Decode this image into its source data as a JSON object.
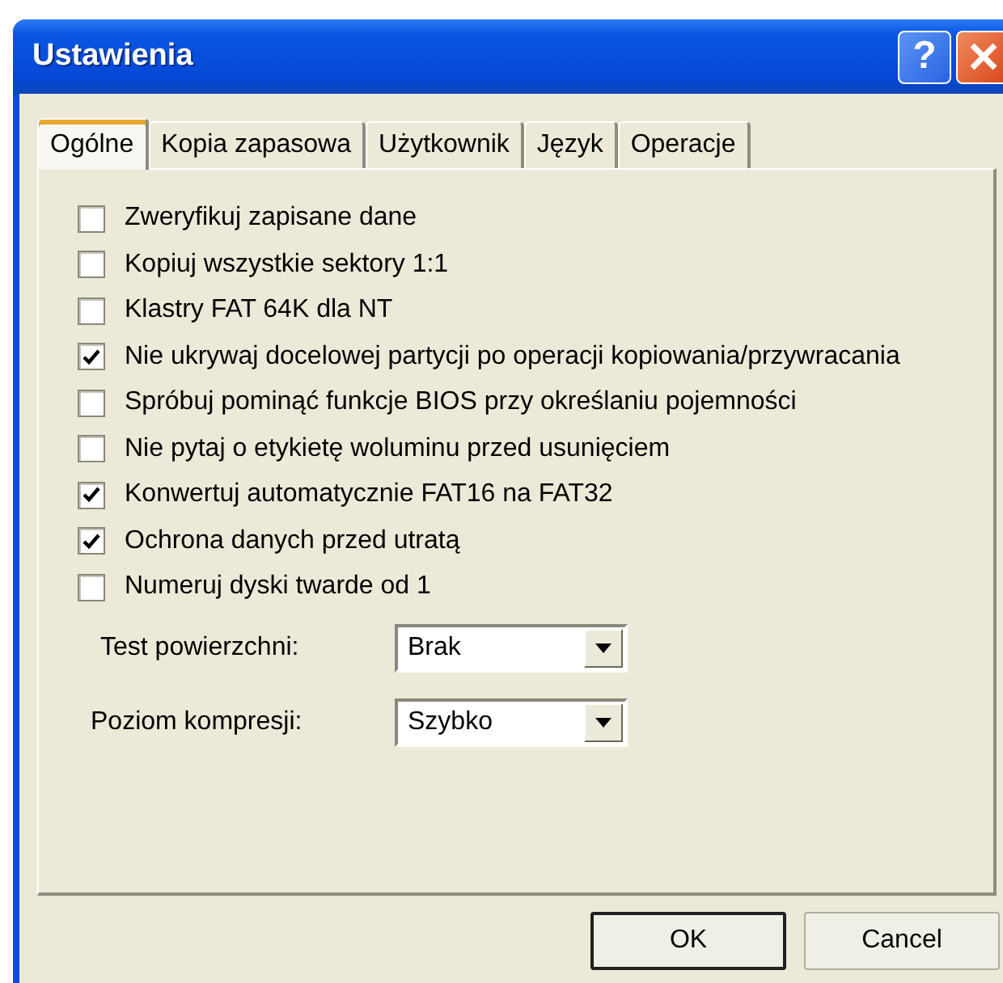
{
  "window": {
    "title": "Ustawienia",
    "help_button": "?"
  },
  "tabs": [
    {
      "label": "Ogólne",
      "selected": true
    },
    {
      "label": "Kopia zapasowa",
      "selected": false
    },
    {
      "label": "Użytkownik",
      "selected": false
    },
    {
      "label": "Język",
      "selected": false
    },
    {
      "label": "Operacje",
      "selected": false
    }
  ],
  "options": [
    {
      "label": "Zweryfikuj zapisane dane",
      "checked": false
    },
    {
      "label": "Kopiuj wszystkie sektory 1:1",
      "checked": false
    },
    {
      "label": "Klastry FAT 64K dla NT",
      "checked": false
    },
    {
      "label": "Nie ukrywaj docelowej partycji po operacji kopiowania/przywracania",
      "checked": true
    },
    {
      "label": "Spróbuj pominąć funkcje BIOS przy określaniu pojemności",
      "checked": false
    },
    {
      "label": "Nie pytaj o etykietę woluminu przed usunięciem",
      "checked": false
    },
    {
      "label": "Konwertuj automatycznie FAT16 na FAT32",
      "checked": true
    },
    {
      "label": "Ochrona danych przed utratą",
      "checked": true
    },
    {
      "label": "Numeruj dyski twarde od 1",
      "checked": false
    }
  ],
  "selects": [
    {
      "label": "Test powierzchni:",
      "value": "Brak"
    },
    {
      "label": "Poziom kompresji:",
      "value": "Szybko"
    }
  ],
  "buttons": [
    {
      "label": "OK",
      "default": true
    },
    {
      "label": "Cancel",
      "default": false
    }
  ]
}
